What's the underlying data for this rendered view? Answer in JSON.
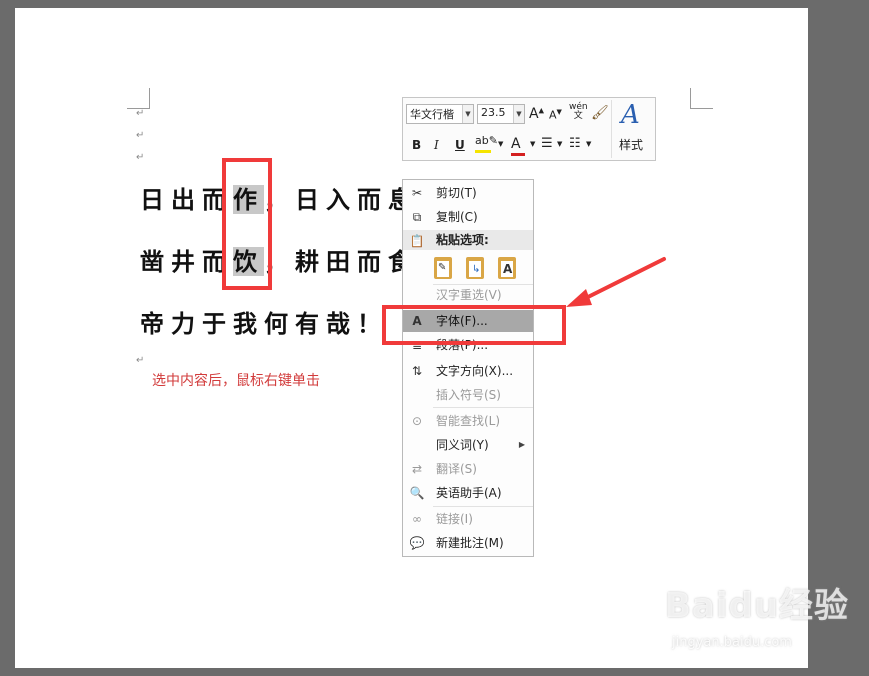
{
  "document": {
    "poem_lines": [
      {
        "before": "日出而",
        "selected": "作",
        "after": "，日入而息"
      },
      {
        "before": "凿井而",
        "selected": "饮",
        "after": "，耕田而食"
      },
      {
        "before": "帝力于我何有哉！",
        "selected": "",
        "after": ""
      }
    ],
    "paragraph_mark": "↵",
    "caption": "选中内容后，鼠标右键单击"
  },
  "mini_toolbar": {
    "font_name": "华文行楷",
    "font_size": "23.5",
    "grow_font": "A",
    "shrink_font": "A",
    "phonetic": "wén",
    "bold": "B",
    "italic": "I",
    "underline": "U",
    "font_color_letter": "A",
    "styles_label": "样式",
    "accent_highlight": "#f5e400",
    "accent_font_color": "#d42020"
  },
  "context_menu": {
    "items": [
      {
        "label": "剪切(T)",
        "icon": "scissors-icon",
        "enabled": true
      },
      {
        "label": "复制(C)",
        "icon": "copy-icon",
        "enabled": true
      },
      {
        "label": "粘贴选项:",
        "icon": "paste-icon",
        "enabled": true,
        "header": true
      },
      {
        "label": "汉字重选(V)",
        "icon": "",
        "enabled": false
      },
      {
        "label": "字体(F)...",
        "icon": "font-icon",
        "enabled": true,
        "highlighted": true
      },
      {
        "label": "段落(P)...",
        "icon": "paragraph-icon",
        "enabled": true
      },
      {
        "label": "文字方向(X)...",
        "icon": "text-direction-icon",
        "enabled": true
      },
      {
        "label": "插入符号(S)",
        "icon": "",
        "enabled": false
      },
      {
        "label": "智能查找(L)",
        "icon": "smart-lookup-icon",
        "enabled": false
      },
      {
        "label": "同义词(Y)",
        "icon": "",
        "enabled": true,
        "submenu": true
      },
      {
        "label": "翻译(S)",
        "icon": "translate-icon",
        "enabled": false
      },
      {
        "label": "英语助手(A)",
        "icon": "english-assistant-icon",
        "enabled": true
      },
      {
        "label": "链接(I)",
        "icon": "link-icon",
        "enabled": false
      },
      {
        "label": "新建批注(M)",
        "icon": "new-comment-icon",
        "enabled": true
      }
    ],
    "paste_options": [
      "keep-source-formatting",
      "merge-formatting",
      "keep-text-only"
    ],
    "paste_text_only_letter": "A",
    "font_icon_letter": "A"
  },
  "annotations": {
    "highlight_color": "#f03a3a"
  },
  "watermark": {
    "brand": "Baidu经验",
    "url": "jingyan.baidu.com"
  }
}
